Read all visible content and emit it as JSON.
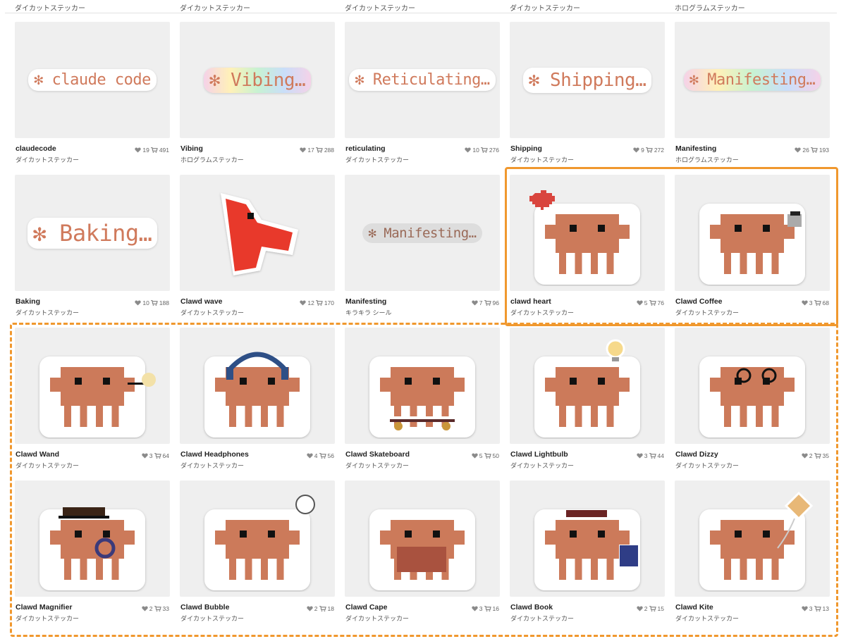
{
  "top_row_labels": [
    "ダイカットステッカー",
    "ダイカットステッカー",
    "ダイカットステッカー",
    "ダイカットステッカー",
    "ホログラムステッカー"
  ],
  "colors": {
    "accent_highlight": "#f0982e",
    "clawd": "#cc7a5a",
    "card_bg": "#efefef"
  },
  "products": [
    {
      "name": "claudecode",
      "type": "ダイカットステッカー",
      "likes": "19",
      "carts": "491",
      "art": "text",
      "text": "✻ claude code",
      "style": "plain"
    },
    {
      "name": "Vibing",
      "type": "ホログラムステッカー",
      "likes": "17",
      "carts": "288",
      "art": "text",
      "text": "✻ Vibing…",
      "style": "holo"
    },
    {
      "name": "reticulating",
      "type": "ダイカットステッカー",
      "likes": "10",
      "carts": "276",
      "art": "text",
      "text": "✻ Reticulating…",
      "style": "plain"
    },
    {
      "name": "Shipping",
      "type": "ダイカットステッカー",
      "likes": "9",
      "carts": "272",
      "art": "text",
      "text": "✻ Shipping…",
      "style": "plain"
    },
    {
      "name": "Manifesting",
      "type": "ホログラムステッカー",
      "likes": "26",
      "carts": "193",
      "art": "text",
      "text": "✻ Manifesting…",
      "style": "holo"
    },
    {
      "name": "Baking",
      "type": "ダイカットステッカー",
      "likes": "10",
      "carts": "188",
      "art": "text",
      "text": "✻ Baking…",
      "style": "plain"
    },
    {
      "name": "Clawd wave",
      "type": "ダイカットステッカー",
      "likes": "12",
      "carts": "170",
      "art": "wave"
    },
    {
      "name": "Manifesting",
      "type": "キラキラ シール",
      "likes": "7",
      "carts": "96",
      "art": "text",
      "text": "✻ Manifesting…",
      "style": "kira"
    },
    {
      "name": "clawd heart",
      "type": "ダイカットステッカー",
      "likes": "5",
      "carts": "76",
      "art": "clawd",
      "accessory": "heart"
    },
    {
      "name": "Clawd Coffee",
      "type": "ダイカットステッカー",
      "likes": "3",
      "carts": "68",
      "art": "clawd",
      "accessory": "coffee"
    },
    {
      "name": "Clawd Wand",
      "type": "ダイカットステッカー",
      "likes": "3",
      "carts": "64",
      "art": "clawd",
      "accessory": "wand"
    },
    {
      "name": "Clawd Headphones",
      "type": "ダイカットステッカー",
      "likes": "4",
      "carts": "56",
      "art": "clawd",
      "accessory": "headphones"
    },
    {
      "name": "Clawd Skateboard",
      "type": "ダイカットステッカー",
      "likes": "5",
      "carts": "50",
      "art": "clawd",
      "accessory": "skateboard"
    },
    {
      "name": "Clawd Lightbulb",
      "type": "ダイカットステッカー",
      "likes": "3",
      "carts": "44",
      "art": "clawd",
      "accessory": "lightbulb"
    },
    {
      "name": "Clawd Dizzy",
      "type": "ダイカットステッカー",
      "likes": "2",
      "carts": "35",
      "art": "clawd",
      "accessory": "dizzy"
    },
    {
      "name": "Clawd Magnifier",
      "type": "ダイカットステッカー",
      "likes": "2",
      "carts": "33",
      "art": "clawd",
      "accessory": "magnifier"
    },
    {
      "name": "Clawd Bubble",
      "type": "ダイカットステッカー",
      "likes": "2",
      "carts": "18",
      "art": "clawd",
      "accessory": "bubble"
    },
    {
      "name": "Clawd Cape",
      "type": "ダイカットステッカー",
      "likes": "3",
      "carts": "16",
      "art": "clawd",
      "accessory": "cape"
    },
    {
      "name": "Clawd Book",
      "type": "ダイカットステッカー",
      "likes": "2",
      "carts": "15",
      "art": "clawd",
      "accessory": "book"
    },
    {
      "name": "Clawd Kite",
      "type": "ダイカットステッカー",
      "likes": "3",
      "carts": "13",
      "art": "clawd",
      "accessory": "kite"
    }
  ]
}
